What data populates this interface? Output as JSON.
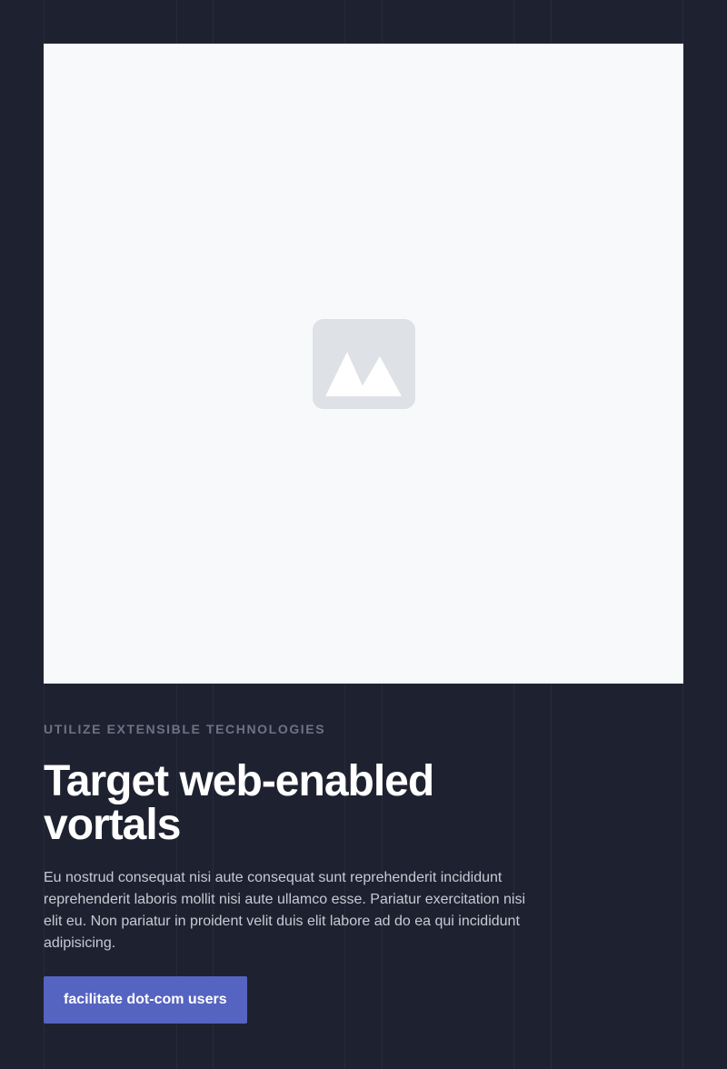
{
  "hero": {
    "image_icon": "image-placeholder-icon"
  },
  "content": {
    "eyebrow": "UTILIZE EXTENSIBLE TECHNOLOGIES",
    "headline": "Target web-enabled vortals",
    "body": "Eu nostrud consequat nisi aute consequat sunt reprehenderit incididunt reprehenderit laboris mollit nisi aute ullamco esse. Pariatur exercitation nisi elit eu. Non pariatur in proident velit duis elit labore ad do ea qui incididunt adipisicing.",
    "cta_label": "facilitate dot-com users"
  },
  "colors": {
    "background": "#1e2230",
    "accent": "#5563c1",
    "image_bg": "#f8f9fa"
  }
}
